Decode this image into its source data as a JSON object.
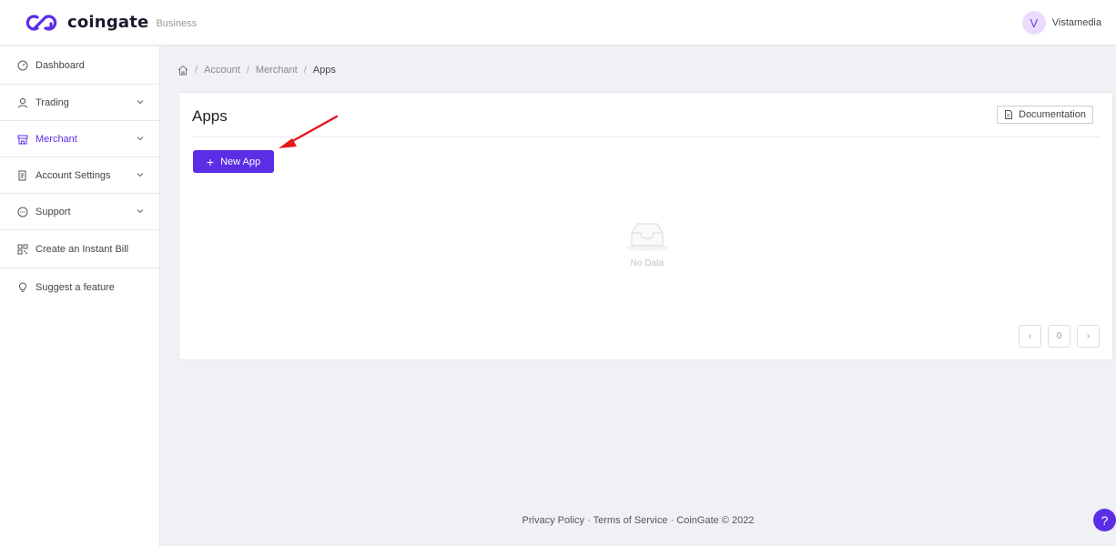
{
  "header": {
    "logo_text": "coingate",
    "logo_sub": "Business",
    "user_initial": "V",
    "user_name": "Vistamedia"
  },
  "sidebar": {
    "items": [
      {
        "label": "Dashboard",
        "icon": "dashboard-icon",
        "expandable": false,
        "active": false
      },
      {
        "label": "Trading",
        "icon": "user-icon",
        "expandable": true,
        "active": false
      },
      {
        "label": "Merchant",
        "icon": "store-icon",
        "expandable": true,
        "active": true
      },
      {
        "label": "Account Settings",
        "icon": "document-icon",
        "expandable": true,
        "active": false
      },
      {
        "label": "Support",
        "icon": "chat-icon",
        "expandable": true,
        "active": false
      },
      {
        "label": "Create an Instant Bill",
        "icon": "qr-icon",
        "expandable": false,
        "active": false
      },
      {
        "label": "Suggest a feature",
        "icon": "lightbulb-icon",
        "expandable": false,
        "active": false
      }
    ]
  },
  "breadcrumb": {
    "items": [
      "Account",
      "Merchant",
      "Apps"
    ]
  },
  "card": {
    "title": "Apps",
    "doc_label": "Documentation",
    "new_app_label": "New App",
    "empty_text": "No Data"
  },
  "pager": {
    "prev": "‹",
    "page": "0",
    "next": "›"
  },
  "footer": {
    "text": "Privacy Policy · Terms of Service · CoinGate © 2022"
  },
  "help": {
    "label": "?"
  },
  "colors": {
    "accent": "#5b2ee6",
    "annotation": "#e8161b"
  }
}
